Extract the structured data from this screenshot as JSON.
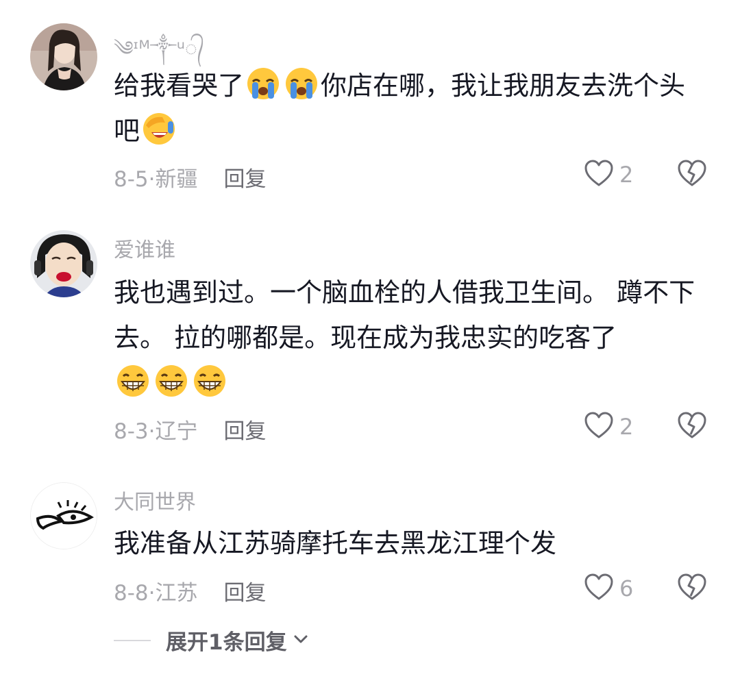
{
  "comments": [
    {
      "username": "༄ᶦᴹ༒ᵘ᭄",
      "text_parts": [
        "给我看哭了",
        "你店在哪，我让我朋友去洗个头吧"
      ],
      "emojis": [
        "loudly-crying-face",
        "loudly-crying-face",
        "facepalm-laughing-face"
      ],
      "date": "8-5",
      "location": "新疆",
      "reply_label": "回复",
      "likes": "2"
    },
    {
      "username": "爱谁谁",
      "text_parts": [
        "我也遇到过。一个脑血栓的人借我卫生间。 蹲不下去。 拉的哪都是。现在成为我忠实的吃客了"
      ],
      "emojis": [
        "grinning-face",
        "grinning-face",
        "grinning-face"
      ],
      "date": "8-3",
      "location": "辽宁",
      "reply_label": "回复",
      "likes": "2"
    },
    {
      "username": "大同世界",
      "text_parts": [
        "我准备从江苏骑摩托车去黑龙江理个发"
      ],
      "emojis": [],
      "date": "8-8",
      "location": "江苏",
      "reply_label": "回复",
      "likes": "6"
    }
  ],
  "separator": "·",
  "expand_label": "展开1条回复",
  "icons": {
    "like": "heart-outline-icon",
    "dislike": "broken-heart-icon",
    "expand": "chevron-down-icon"
  },
  "colors": {
    "text": "#161823",
    "meta": "#a8a8ad",
    "reply": "#6c6c73",
    "emoji_yellow": "#ffc83d",
    "tear_blue": "#4a90e2"
  }
}
